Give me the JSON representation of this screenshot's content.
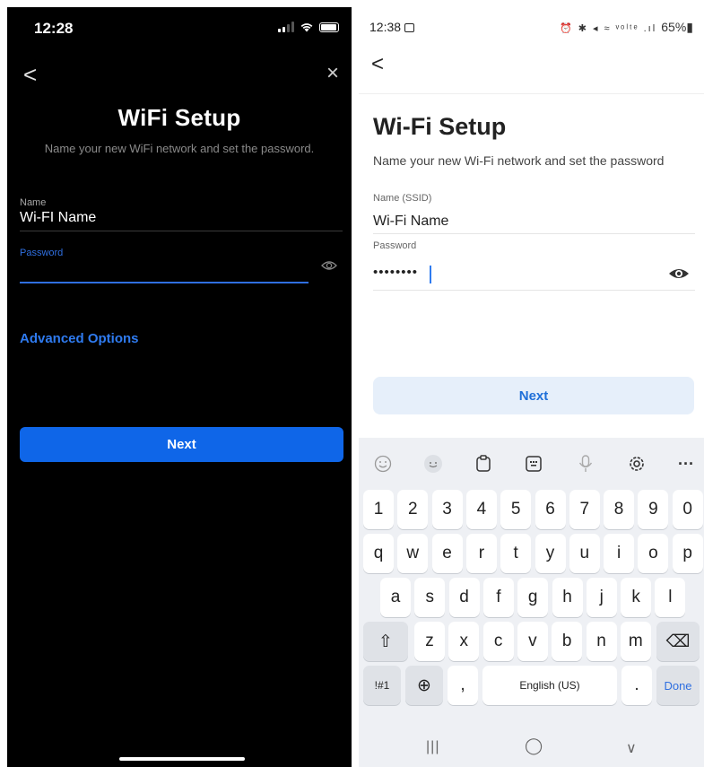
{
  "left": {
    "status_time": "12:28",
    "back_glyph": "<",
    "close_glyph": "×",
    "title": "WiFi Setup",
    "subtitle": "Name your new WiFi network and set the password.",
    "name_label": "Name",
    "name_value": "Wi-FI Name",
    "password_label": "Password",
    "password_value": "",
    "advanced_label": "Advanced Options",
    "next_label": "Next",
    "colors": {
      "background": "#000000",
      "accent": "#0f66e8",
      "link": "#2f7bf0"
    }
  },
  "right": {
    "status_time": "12:38",
    "status_icons": "⏰ ✱ ◂ ≈ ᵛᵒˡᵗᵉ .ıl",
    "battery": "65%",
    "back_glyph": "<",
    "title": "Wi-Fi Setup",
    "subtitle": "Name your new Wi-Fi network and set the password",
    "name_label": "Name (SSID)",
    "name_value": "Wi-Fi Name",
    "password_label": "Password",
    "password_value": "••••••••",
    "next_label": "Next",
    "colors": {
      "background": "#ffffff",
      "accent": "#1f6fd8",
      "button_bg": "#e6effa"
    },
    "keyboard": {
      "toolbar_icons": [
        "emoji-icon",
        "sticker-icon",
        "clipboard-icon",
        "keyboard-mode-icon",
        "microphone-icon",
        "settings-icon",
        "more-icon"
      ],
      "more_glyph": "···",
      "row_numbers": [
        "1",
        "2",
        "3",
        "4",
        "5",
        "6",
        "7",
        "8",
        "9",
        "0"
      ],
      "row1": [
        "q",
        "w",
        "e",
        "r",
        "t",
        "y",
        "u",
        "i",
        "o",
        "p"
      ],
      "row2": [
        "a",
        "s",
        "d",
        "f",
        "g",
        "h",
        "j",
        "k",
        "l"
      ],
      "row3": [
        "z",
        "x",
        "c",
        "v",
        "b",
        "n",
        "m"
      ],
      "shift_glyph": "⇧",
      "backspace_glyph": "⌫",
      "symbols_label": "!#1",
      "globe_glyph": "⊕",
      "comma": ",",
      "space_label": "English (US)",
      "period": ".",
      "done_label": "Done"
    },
    "navbar": {
      "recents": "|||",
      "home": "◯",
      "back": "∨"
    }
  }
}
